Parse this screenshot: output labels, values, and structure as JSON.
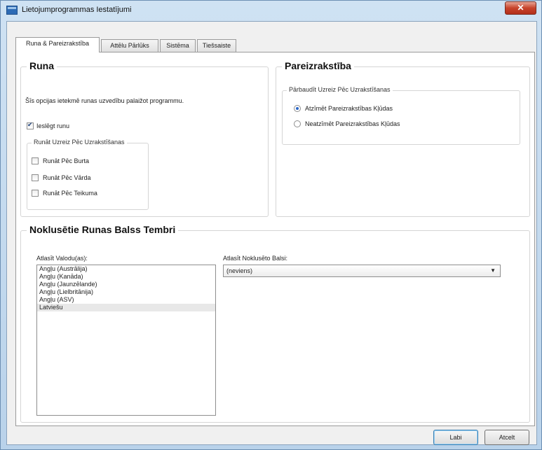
{
  "window": {
    "title": "Lietojumprogrammas Iestatījumi",
    "close_symbol": "✕"
  },
  "tabs": [
    {
      "label": "Runa & Pareizrakstība"
    },
    {
      "label": "Attēlu Pārlūks"
    },
    {
      "label": "Sistēma"
    },
    {
      "label": "Tiešsaiste"
    }
  ],
  "runa": {
    "title": "Runa",
    "description": "Šīs opcijas ietekmē runas uzvedību palaižot programmu.",
    "enable_label": "Ieslēgt runu",
    "enable_checked": true,
    "sub_title": "Runāt Uzreiz Pēc Uzrakstīšanas",
    "options": [
      {
        "label": "Runāt Pēc Burta",
        "checked": false
      },
      {
        "label": "Runāt Pēc Vārda",
        "checked": false
      },
      {
        "label": "Runāt Pēc Teikuma",
        "checked": false
      }
    ]
  },
  "spell": {
    "title": "Pareizrakstība",
    "sub_title": "Pārbaudīt Uzreiz Pēc Uzrakstīšanas",
    "options": [
      {
        "label": "Atzīmēt Pareizrakstības Kļūdas",
        "selected": true
      },
      {
        "label": "Neatzīmēt Pareizrakstības Kļūdas",
        "selected": false
      }
    ]
  },
  "voices": {
    "title": "Noklusētie Runas Balss Tembri",
    "language_label": "Atlasīt Valodu(as):",
    "languages": [
      "Angļu (Austrālija)",
      "Angļu (Kanāda)",
      "Angļu (Jaunzēlande)",
      "Angļu (Lielbritānija)",
      "Angļu (ASV)",
      "Latviešu"
    ],
    "selected_language_index": 5,
    "voice_label": "Atlasīt Noklusēto Balsi:",
    "voice_value": "(neviens)"
  },
  "buttons": {
    "ok": "Labi",
    "cancel": "Atcelt"
  }
}
